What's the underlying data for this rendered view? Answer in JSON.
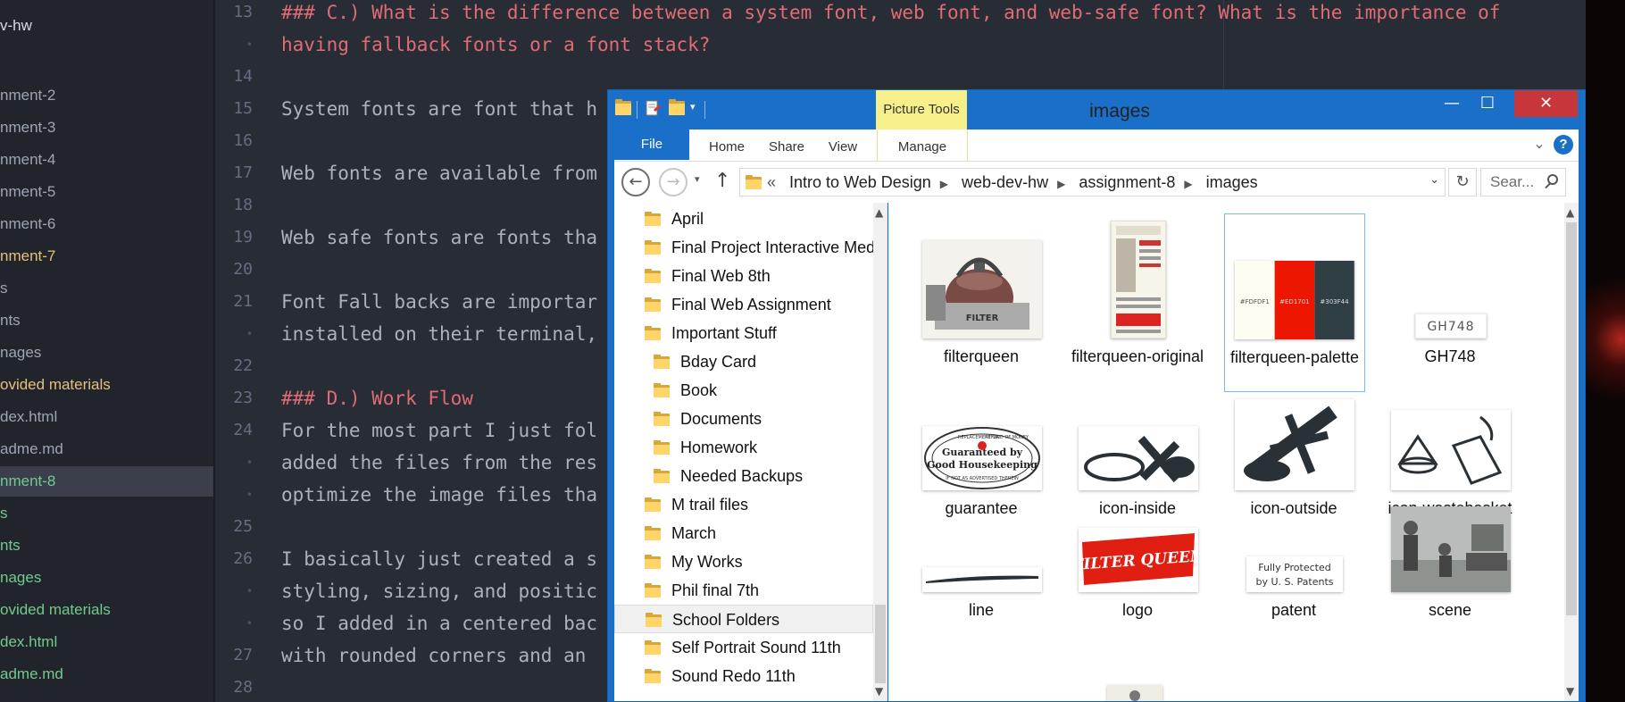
{
  "sidebar": {
    "root": "v-hw",
    "items": [
      {
        "label": "nment-2",
        "color": "#9da5b4"
      },
      {
        "label": "nment-3",
        "color": "#9da5b4"
      },
      {
        "label": "nment-4",
        "color": "#9da5b4"
      },
      {
        "label": "nment-5",
        "color": "#9da5b4"
      },
      {
        "label": "nment-6",
        "color": "#9da5b4"
      },
      {
        "label": "nment-7",
        "color": "#e5c07b"
      },
      {
        "label": "s",
        "color": "#9da5b4"
      },
      {
        "label": "nts",
        "color": "#9da5b4"
      },
      {
        "label": "nages",
        "color": "#9da5b4"
      },
      {
        "label": "ovided materials",
        "color": "#e5c07b"
      },
      {
        "label": "dex.html",
        "color": "#9da5b4"
      },
      {
        "label": "adme.md",
        "color": "#9da5b4"
      },
      {
        "label": "nment-8",
        "color": "#73c990"
      },
      {
        "label": "s",
        "color": "#73c990"
      },
      {
        "label": "nts",
        "color": "#73c990"
      },
      {
        "label": "nages",
        "color": "#73c990"
      },
      {
        "label": "ovided materials",
        "color": "#73c990"
      },
      {
        "label": "dex.html",
        "color": "#73c990"
      },
      {
        "label": "adme.md",
        "color": "#73c990"
      }
    ]
  },
  "editor": {
    "lines": [
      {
        "num": "13",
        "text": "### C.) What is the difference between a system font, web font, and web-safe font? What is the importance of",
        "kind": "head"
      },
      {
        "num": "•",
        "text": "having fallback fonts or a font stack?",
        "kind": "head"
      },
      {
        "num": "14",
        "text": "",
        "kind": "plain"
      },
      {
        "num": "15",
        "text": "System fonts are font that h",
        "kind": "plain"
      },
      {
        "num": "16",
        "text": "",
        "kind": "plain"
      },
      {
        "num": "17",
        "text": "Web fonts are available from",
        "kind": "plain"
      },
      {
        "num": "18",
        "text": "",
        "kind": "plain"
      },
      {
        "num": "19",
        "text": "Web safe fonts are fonts tha",
        "kind": "plain"
      },
      {
        "num": "20",
        "text": "",
        "kind": "plain"
      },
      {
        "num": "21",
        "text": "Font Fall backs are importar",
        "kind": "plain"
      },
      {
        "num": "•",
        "text": "installed on their terminal,",
        "kind": "plain"
      },
      {
        "num": "22",
        "text": "",
        "kind": "plain"
      },
      {
        "num": "23",
        "text": "### D.) Work Flow",
        "kind": "head"
      },
      {
        "num": "24",
        "text": "For the most part I just fol",
        "kind": "plain"
      },
      {
        "num": "•",
        "text": "added the files from the res",
        "kind": "plain"
      },
      {
        "num": "•",
        "text": "optimize the image files tha",
        "kind": "plain"
      },
      {
        "num": "25",
        "text": "",
        "kind": "plain"
      },
      {
        "num": "26",
        "text": "I basically just created a s",
        "kind": "plain"
      },
      {
        "num": "•",
        "text": "styling, sizing, and positic",
        "kind": "plain"
      },
      {
        "num": "•",
        "text": "so I added in a centered bac",
        "kind": "plain"
      },
      {
        "num": "27",
        "text": "with rounded corners and an",
        "kind": "plain"
      },
      {
        "num": "28",
        "text": "",
        "kind": "plain"
      }
    ]
  },
  "explorer": {
    "title": "images",
    "context_tab": "Picture Tools",
    "window_buttons": {
      "minimize": "—",
      "maximize": "☐",
      "close": "✕"
    },
    "ribbon_tabs": [
      "File",
      "Home",
      "Share",
      "View",
      "Manage"
    ],
    "help": "?",
    "breadcrumb": [
      "Intro to Web Design",
      "web-dev-hw",
      "assignment-8",
      "images"
    ],
    "breadcrumb_prefix": "«",
    "search_placeholder": "Sear...",
    "tree": [
      {
        "label": "April",
        "indent": 0,
        "selected": false
      },
      {
        "label": "Final Project Interactive Medi",
        "indent": 0,
        "selected": false
      },
      {
        "label": "Final Web 8th",
        "indent": 0,
        "selected": false
      },
      {
        "label": "Final Web Assignment",
        "indent": 0,
        "selected": false
      },
      {
        "label": "Important Stuff",
        "indent": 0,
        "selected": false
      },
      {
        "label": "Bday Card",
        "indent": 1,
        "selected": false
      },
      {
        "label": "Book",
        "indent": 1,
        "selected": false
      },
      {
        "label": "Documents",
        "indent": 1,
        "selected": false
      },
      {
        "label": "Homework",
        "indent": 1,
        "selected": false
      },
      {
        "label": "Needed Backups",
        "indent": 1,
        "selected": false
      },
      {
        "label": "M trail files",
        "indent": 0,
        "selected": false
      },
      {
        "label": "March",
        "indent": 0,
        "selected": false
      },
      {
        "label": "My Works",
        "indent": 0,
        "selected": false
      },
      {
        "label": "Phil final 7th",
        "indent": 0,
        "selected": false
      },
      {
        "label": "School Folders",
        "indent": 0,
        "selected": true
      },
      {
        "label": "Self Portrait Sound 11th",
        "indent": 0,
        "selected": false
      },
      {
        "label": "Sound Redo 11th",
        "indent": 0,
        "selected": false
      }
    ],
    "files": [
      {
        "name": "filterqueen",
        "thumb": "kettle",
        "selected": false
      },
      {
        "name": "filterqueen-original",
        "thumb": "ad",
        "selected": false
      },
      {
        "name": "filterqueen-palette",
        "thumb": "palette",
        "selected": true
      },
      {
        "name": "GH748",
        "thumb": "gh748",
        "selected": false
      },
      {
        "name": "guarantee",
        "thumb": "seal",
        "selected": false
      },
      {
        "name": "icon-inside",
        "thumb": "inside",
        "selected": false
      },
      {
        "name": "icon-outside",
        "thumb": "outside",
        "selected": false
      },
      {
        "name": "icon-wastebasket",
        "thumb": "waste",
        "selected": false
      },
      {
        "name": "line",
        "thumb": "line",
        "selected": false
      },
      {
        "name": "logo",
        "thumb": "logo",
        "selected": false
      },
      {
        "name": "patent",
        "thumb": "patent",
        "selected": false
      },
      {
        "name": "scene",
        "thumb": "scene",
        "selected": false
      }
    ],
    "palette_swatches": [
      {
        "hex": "#FDFDF1",
        "label": "#FDFDF1"
      },
      {
        "hex": "#ED1701",
        "label": "#ED1701"
      },
      {
        "hex": "#303F44",
        "label": "#303F44"
      }
    ],
    "gh748_text": "GH748",
    "seal_text": [
      "REPLACEMENT OR",
      "REFUND OF MONEY",
      "Guaranteed by",
      "Good Housekeeping",
      "IF NOT AS ADVERTISED THEREIN"
    ],
    "logo_text": "FILTER QUEEN",
    "patent_text": [
      "Fully Protected",
      "by U. S. Patents"
    ]
  },
  "colors": {
    "editor_bg": "#282c34",
    "sidebar_bg": "#21252b",
    "heading": "#e06c75",
    "explorer_frame": "#1a6fc9",
    "close_button": "#c7373a",
    "picture_tools": "#f7ef8a"
  }
}
